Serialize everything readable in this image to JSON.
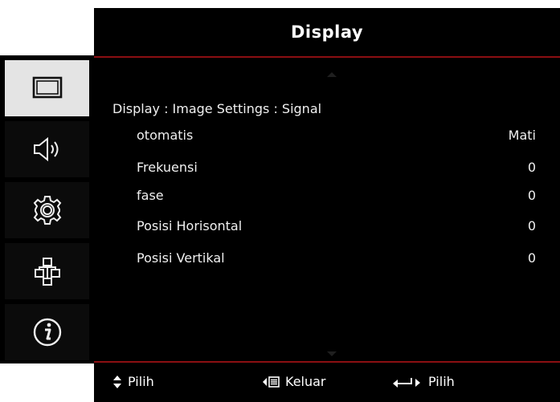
{
  "header": {
    "title": "Display"
  },
  "breadcrumb": "Display : Image Settings : Signal",
  "settings": [
    {
      "label": "otomatis",
      "value": "Mati"
    },
    {
      "label": "Frekuensi",
      "value": "0"
    },
    {
      "label": "fase",
      "value": "0"
    },
    {
      "label": "Posisi Horisontal",
      "value": "0"
    },
    {
      "label": "Posisi Vertikal",
      "value": "0"
    }
  ],
  "footer": {
    "navigate": "Pilih",
    "exit": "Keluar",
    "enter": "Pilih"
  },
  "sidebar": {
    "tabs": [
      {
        "icon": "display-icon",
        "active": true
      },
      {
        "icon": "speaker-icon",
        "active": false
      },
      {
        "icon": "gear-icon",
        "active": false
      },
      {
        "icon": "network-icon",
        "active": false
      },
      {
        "icon": "info-icon",
        "active": false
      }
    ]
  },
  "colors": {
    "accent": "#8b0f12",
    "background": "#000000",
    "text": "#f0f0f0",
    "active_tab": "#e4e4e4"
  }
}
